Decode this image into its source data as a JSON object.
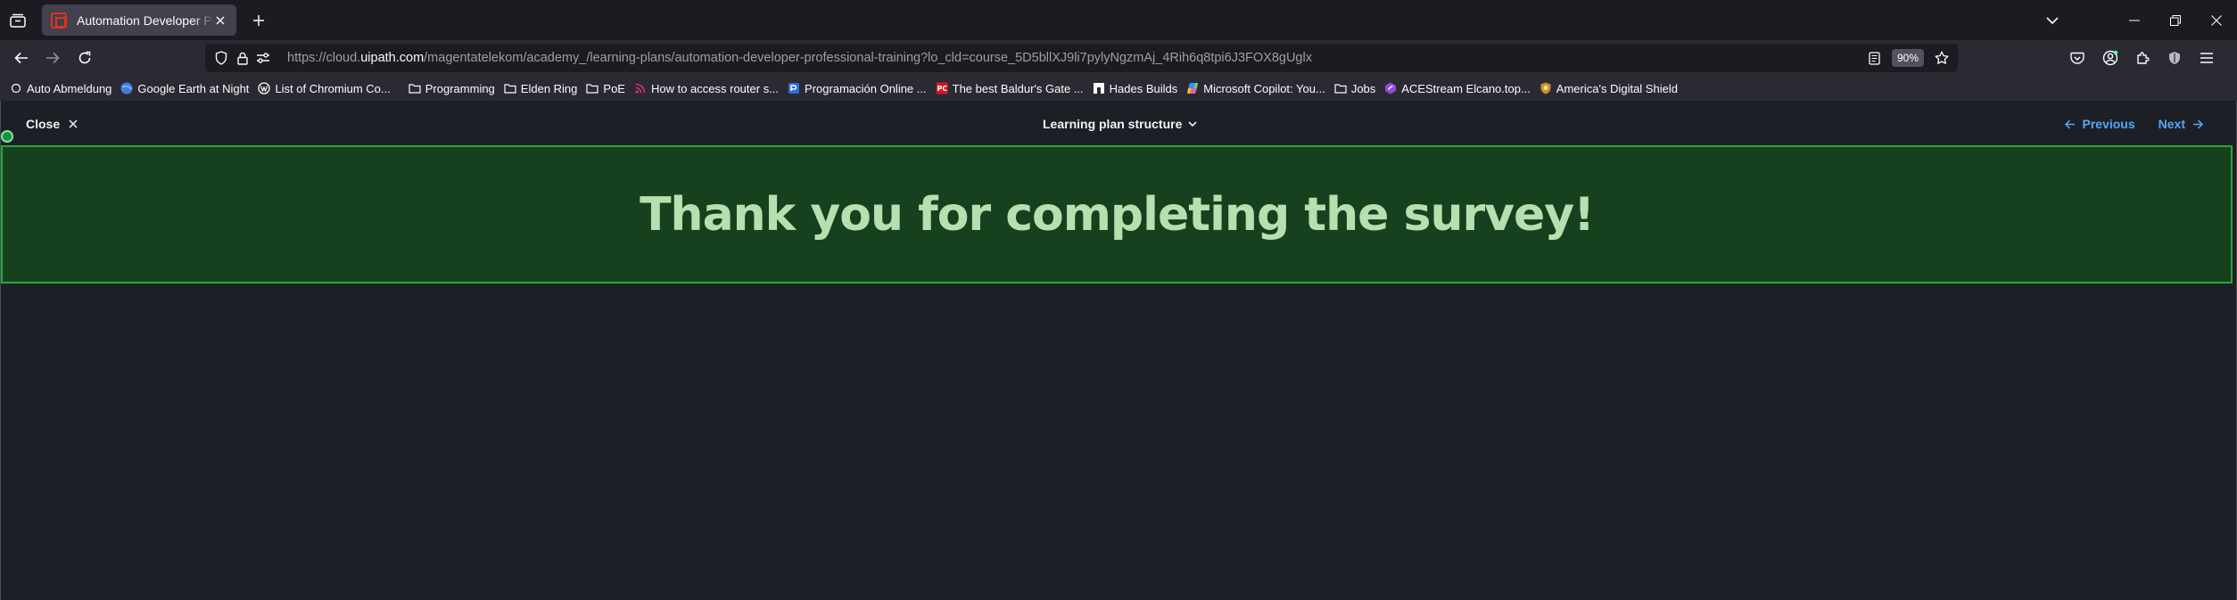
{
  "browser": {
    "tab": {
      "title": "Automation Developer Professional Training"
    },
    "url": {
      "prefix": "https://cloud.",
      "domain": "uipath.com",
      "path": "/magentatelekom/academy_/learning-plans/automation-developer-professional-training?lo_cld=course_5D5bllXJ9li7pylyNgzmAj_4Rih6q8tpi6J3FOX8gUglx"
    },
    "zoom": "90%",
    "bookmarks": [
      {
        "label": "Auto Abmeldung",
        "icon": "plain-link-icon"
      },
      {
        "label": "Google Earth at Night",
        "icon": "globe-icon"
      },
      {
        "label": "List of Chromium Co...",
        "icon": "wordpress-icon"
      },
      {
        "label": "Programming",
        "icon": "folder-icon"
      },
      {
        "label": "Elden Ring",
        "icon": "folder-icon"
      },
      {
        "label": "PoE",
        "icon": "folder-icon"
      },
      {
        "label": "How to access router s...",
        "icon": "rss-icon"
      },
      {
        "label": "Programación Online ...",
        "icon": "site-icon"
      },
      {
        "label": "The best Baldur's Gate ...",
        "icon": "pcgamer-icon"
      },
      {
        "label": "Hades Builds",
        "icon": "hades-icon"
      },
      {
        "label": "Microsoft Copilot: You...",
        "icon": "copilot-icon"
      },
      {
        "label": "Jobs",
        "icon": "folder-icon"
      },
      {
        "label": "ACEStream Elcano.top...",
        "icon": "acestream-icon"
      },
      {
        "label": "America's Digital Shield",
        "icon": "shield-badge-icon"
      }
    ]
  },
  "page": {
    "close_label": "Close",
    "plan_structure_label": "Learning plan structure",
    "previous_label": "Previous",
    "next_label": "Next",
    "survey_message": "Thank you for completing the survey!"
  },
  "colors": {
    "accent_link": "#53a8f8",
    "banner_bg": "#17411e",
    "banner_border": "#26a83b",
    "banner_text": "#b7dfb0"
  }
}
